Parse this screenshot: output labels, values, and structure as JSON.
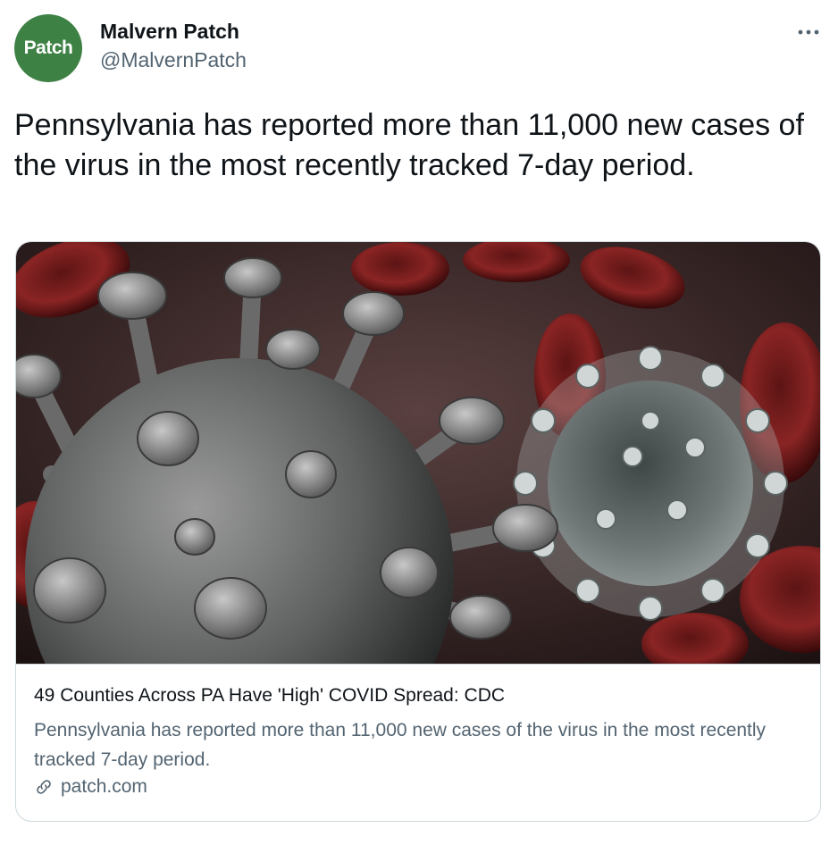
{
  "author": {
    "avatar_text": "Patch",
    "display_name": "Malvern Patch",
    "handle": "@MalvernPatch"
  },
  "tweet": {
    "text": "Pennsylvania has reported more than 11,000 new cases of the virus in the most recently tracked 7-day period."
  },
  "card": {
    "title": "49 Counties Across PA Have 'High' COVID Spread: CDC",
    "description": "Pennsylvania has reported more than 11,000 new cases of the virus in the most recently tracked 7-day period.",
    "domain": "patch.com"
  },
  "icons": {
    "more": "more-horizontal-icon",
    "link": "link-icon"
  },
  "colors": {
    "avatar_bg": "#3e8145",
    "text_primary": "#0f1419",
    "text_secondary": "#536471",
    "border": "#cfd9de"
  }
}
